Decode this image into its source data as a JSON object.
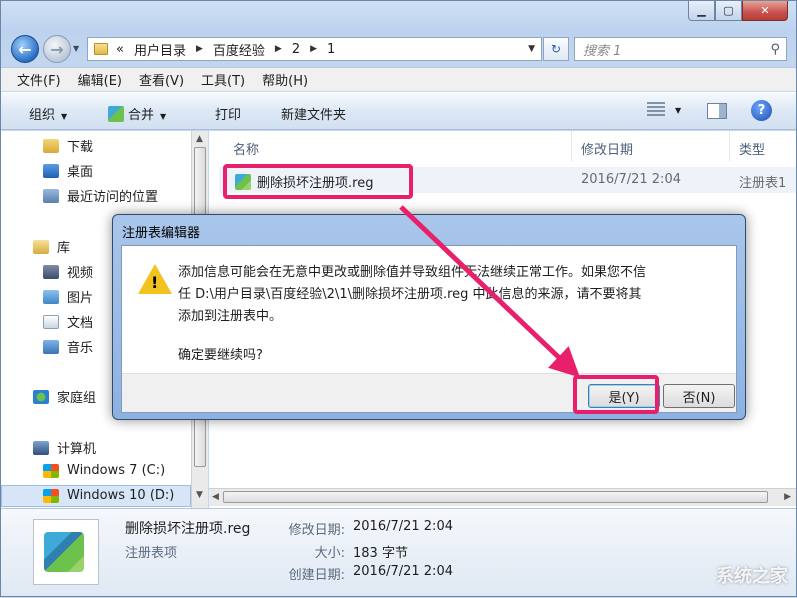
{
  "address": {
    "crumbs": [
      "«",
      "用户目录",
      "百度经验",
      "2",
      "1"
    ],
    "search_placeholder": "搜索 1"
  },
  "menu": [
    "文件(F)",
    "编辑(E)",
    "查看(V)",
    "工具(T)",
    "帮助(H)"
  ],
  "toolbar": {
    "organize": "组织",
    "merge": "合并",
    "print": "打印",
    "new_folder": "新建文件夹"
  },
  "nav": {
    "items": [
      "下载",
      "桌面",
      "最近访问的位置",
      "库",
      "视频",
      "图片",
      "文档",
      "音乐",
      "家庭组",
      "计算机",
      "Windows 7 (C:)",
      "Windows 10 (D:)"
    ]
  },
  "columns": [
    "名称",
    "修改日期",
    "类型"
  ],
  "file": {
    "name": "删除损坏注册项.reg",
    "date": "2016/7/21 2:04",
    "type": "注册表1"
  },
  "details": {
    "name": "删除损坏注册项.reg",
    "kind": "注册表项",
    "labels": [
      "修改日期:",
      "大小:",
      "创建日期:"
    ],
    "values": [
      "2016/7/21 2:04",
      "183 字节",
      "2016/7/21 2:04"
    ]
  },
  "dialog": {
    "title": "注册表编辑器",
    "line1": "添加信息可能会在无意中更改或删除值并导致组件无法继续正常工作。如果您不信",
    "line2": "任 D:\\用户目录\\百度经验\\2\\1\\删除损坏注册项.reg 中此信息的来源，请不要将其",
    "line3": "添加到注册表中。",
    "question": "确定要继续吗?",
    "yes": "是(Y)",
    "no": "否(N)"
  },
  "watermark": "系统之家",
  "colors": {
    "highlight": "#e8206c",
    "selection": "#d7e6f7"
  }
}
